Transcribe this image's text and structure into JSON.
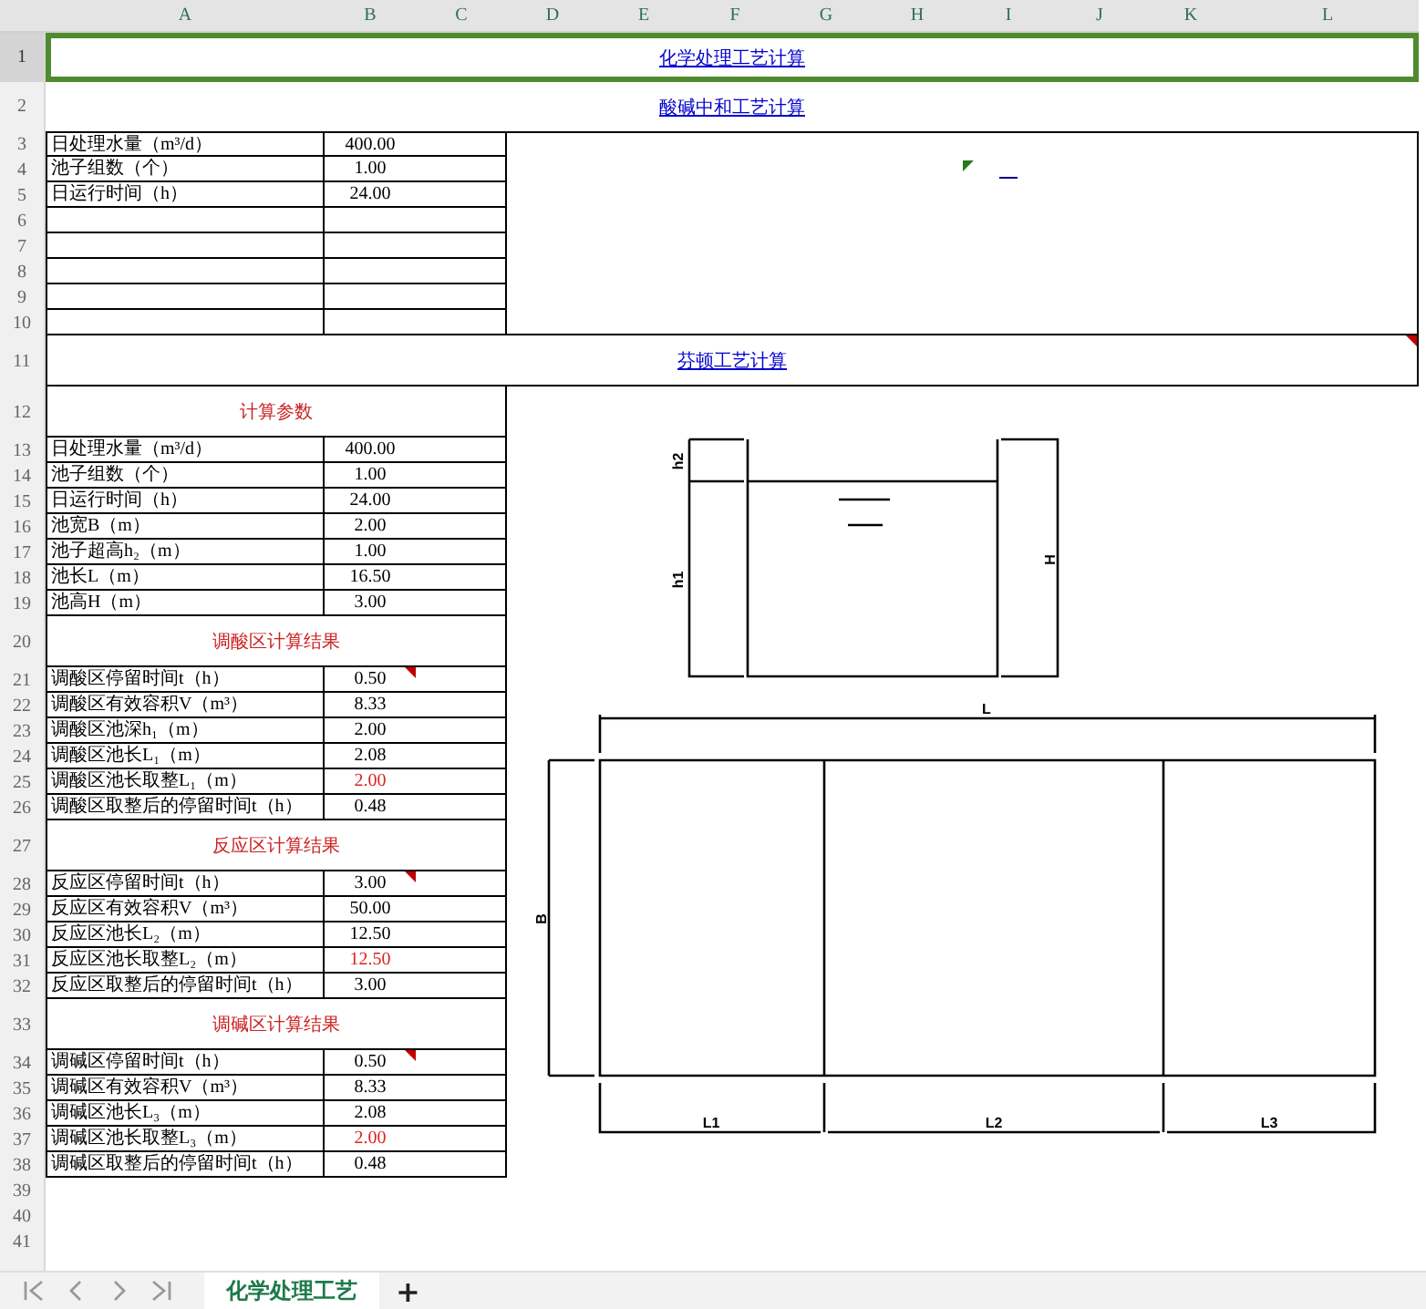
{
  "column_headers": [
    "A",
    "B",
    "C",
    "D",
    "E",
    "F",
    "G",
    "H",
    "I",
    "J",
    "K",
    "L"
  ],
  "rows": [
    {
      "number": "1",
      "kind": "title_link",
      "text": "化学处理工艺计算",
      "selected": true
    },
    {
      "number": "2",
      "kind": "title_link",
      "text": "酸碱中和工艺计算",
      "selected": false
    },
    {
      "number": "3",
      "kind": "param",
      "label": "日处理水量（m³/d）",
      "value": "400.00"
    },
    {
      "number": "4",
      "kind": "param",
      "label": "池子组数（个）",
      "value": "1.00"
    },
    {
      "number": "5",
      "kind": "param",
      "label": "日运行时间（h）",
      "value": "24.00"
    },
    {
      "number": "6",
      "kind": "empty_param"
    },
    {
      "number": "7",
      "kind": "empty_param"
    },
    {
      "number": "8",
      "kind": "empty_param"
    },
    {
      "number": "9",
      "kind": "empty_param"
    },
    {
      "number": "10",
      "kind": "empty_param"
    },
    {
      "number": "11",
      "kind": "boxed_link",
      "text": "芬顿工艺计算",
      "comment": true
    },
    {
      "number": "12",
      "kind": "section",
      "text": "计算参数"
    },
    {
      "number": "13",
      "kind": "param",
      "label": "日处理水量（m³/d）",
      "value": "400.00"
    },
    {
      "number": "14",
      "kind": "param",
      "label": "池子组数（个）",
      "value": "1.00"
    },
    {
      "number": "15",
      "kind": "param",
      "label": "日运行时间（h）",
      "value": "24.00"
    },
    {
      "number": "16",
      "kind": "param",
      "label": "池宽B（m）",
      "value": "2.00"
    },
    {
      "number": "17",
      "kind": "param",
      "label": "池子超高h₂（m）",
      "value": "1.00"
    },
    {
      "number": "18",
      "kind": "param",
      "label": "池长L（m）",
      "value": "16.50"
    },
    {
      "number": "19",
      "kind": "param",
      "label": "池高H（m）",
      "value": "3.00"
    },
    {
      "number": "20",
      "kind": "section",
      "text": "调酸区计算结果"
    },
    {
      "number": "21",
      "kind": "param",
      "label": "调酸区停留时间t（h）",
      "value": "0.50",
      "comment": true
    },
    {
      "number": "22",
      "kind": "param",
      "label": "调酸区有效容积V（m³）",
      "value": "8.33"
    },
    {
      "number": "23",
      "kind": "param",
      "label": "调酸区池深h₁（m）",
      "value": "2.00"
    },
    {
      "number": "24",
      "kind": "param",
      "label": "调酸区池长L₁（m）",
      "value": "2.08"
    },
    {
      "number": "25",
      "kind": "param",
      "label": "调酸区池长取整L₁（m）",
      "value": "2.00",
      "highlight": true
    },
    {
      "number": "26",
      "kind": "param",
      "label": "调酸区取整后的停留时间t（h）",
      "value": "0.48"
    },
    {
      "number": "27",
      "kind": "section",
      "text": "反应区计算结果"
    },
    {
      "number": "28",
      "kind": "param",
      "label": "反应区停留时间t（h）",
      "value": "3.00",
      "comment": true
    },
    {
      "number": "29",
      "kind": "param",
      "label": "反应区有效容积V（m³）",
      "value": "50.00"
    },
    {
      "number": "30",
      "kind": "param",
      "label": "反应区池长L₂（m）",
      "value": "12.50"
    },
    {
      "number": "31",
      "kind": "param",
      "label": "反应区池长取整L₂（m）",
      "value": "12.50",
      "highlight": true
    },
    {
      "number": "32",
      "kind": "param",
      "label": "反应区取整后的停留时间t（h）",
      "value": "3.00"
    },
    {
      "number": "33",
      "kind": "section",
      "text": "调碱区计算结果"
    },
    {
      "number": "34",
      "kind": "param",
      "label": "调碱区停留时间t（h）",
      "value": "0.50",
      "comment": true
    },
    {
      "number": "35",
      "kind": "param",
      "label": "调碱区有效容积V（m³）",
      "value": "8.33"
    },
    {
      "number": "36",
      "kind": "param",
      "label": "调碱区池长L₃（m）",
      "value": "2.08"
    },
    {
      "number": "37",
      "kind": "param",
      "label": "调碱区池长取整L₃（m）",
      "value": "2.00",
      "highlight": true
    },
    {
      "number": "38",
      "kind": "param",
      "label": "调碱区取整后的停留时间t（h）",
      "value": "0.48"
    },
    {
      "number": "39",
      "kind": "blank"
    },
    {
      "number": "40",
      "kind": "blank"
    },
    {
      "number": "41",
      "kind": "blank"
    }
  ],
  "side_panel": {
    "note": true
  },
  "diagram": {
    "section_labels": [
      "h2",
      "h1",
      "H"
    ],
    "plan_labels": [
      "L",
      "B",
      "L1",
      "L2",
      "L3"
    ]
  },
  "sheet_tabs": [
    {
      "label": "化学处理工艺",
      "selected": true
    }
  ],
  "add_sheet": "+"
}
